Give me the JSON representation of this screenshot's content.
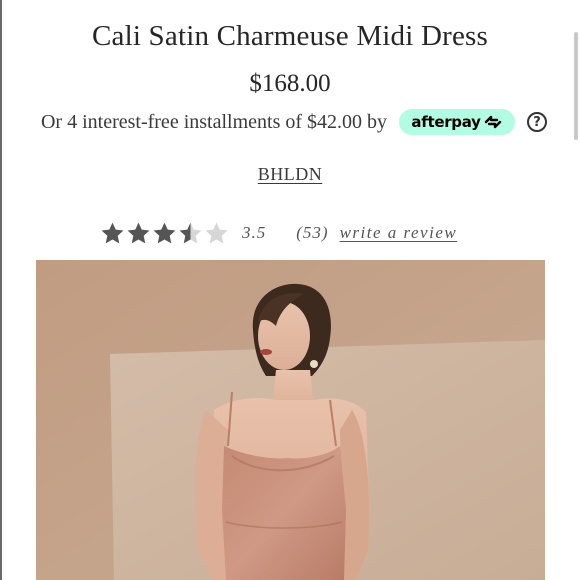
{
  "product": {
    "title": "Cali Satin Charmeuse Midi Dress",
    "price": "$168.00",
    "installments_text": "Or 4 interest-free installments of $42.00 by",
    "afterpay_label": "afterpay",
    "brand": "BHLDN"
  },
  "rating": {
    "value": 3.5,
    "value_text": "3.5",
    "count_text": "(53)",
    "write_review_label": "write a review",
    "max_stars": 5
  },
  "icons": {
    "info": "info-circle-icon",
    "afterpay_logo": "afterpay-arrows-icon",
    "star": "star-icon"
  },
  "colors": {
    "afterpay_mint": "#b2fce4",
    "star_filled": "#555555",
    "star_empty": "#d6d6d6",
    "text": "#262626",
    "photo_background": "#c6a48a",
    "dress": "#c88e76"
  }
}
